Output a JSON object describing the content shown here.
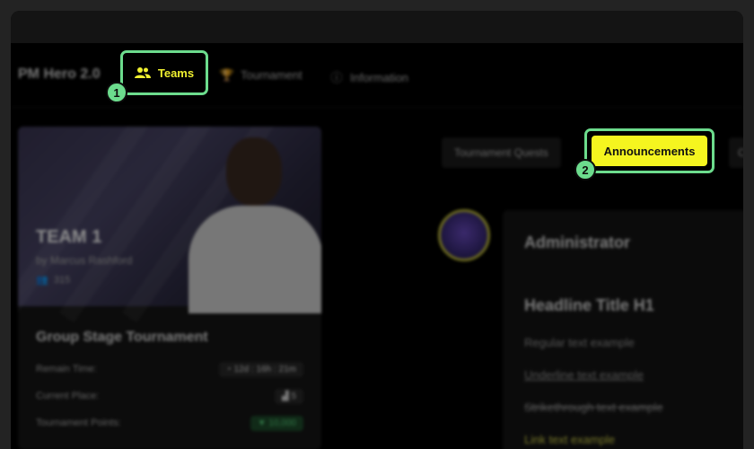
{
  "nav": {
    "logo": "PM Hero 2.0",
    "items": [
      {
        "label": "Teams",
        "icon": "users-icon"
      },
      {
        "label": "Tournament",
        "icon": "trophy-icon"
      },
      {
        "label": "Information",
        "icon": "info-icon"
      }
    ]
  },
  "team_card": {
    "name": "TEAM 1",
    "owner": "by Marcus Rashford",
    "members": "315",
    "tournament_title": "Group Stage Tournament",
    "stats": [
      {
        "label": "Remain Time:",
        "value": "12d : 16h : 21m"
      },
      {
        "label": "Current Place:",
        "value": "5"
      },
      {
        "label": "Tournament Points:",
        "value": "10,000"
      }
    ]
  },
  "tabs": [
    {
      "label": "Tournament Quests"
    },
    {
      "label": "Announcements",
      "active": true
    },
    {
      "label": "Co"
    }
  ],
  "post": {
    "author": "Administrator",
    "headline": "Headline Title H1",
    "regular": "Regular text example",
    "underline": "Underline text example",
    "strike": "Strikethrough text example",
    "link": "Link text example"
  },
  "markers": {
    "one": "1",
    "two": "2"
  },
  "colors": {
    "highlight_border": "#6cdc8d",
    "accent_yellow": "#f5f51f",
    "teams_text": "#f0f030"
  }
}
